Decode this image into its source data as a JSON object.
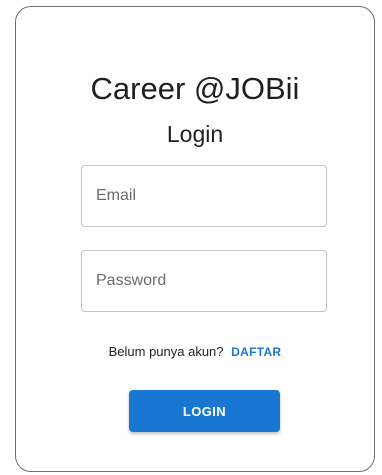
{
  "header": {
    "title": "Career @JOBii",
    "subtitle": "Login"
  },
  "form": {
    "email": {
      "placeholder": "Email",
      "value": ""
    },
    "password": {
      "placeholder": "Password",
      "value": ""
    },
    "signup_prompt": "Belum punya akun?",
    "signup_link": "DAFTAR",
    "login_button": "LOGIN"
  },
  "colors": {
    "accent": "#1976d2",
    "text": "#1f1f1f",
    "card_border": "#6f6f6f",
    "input_border": "#c4c4c4"
  }
}
